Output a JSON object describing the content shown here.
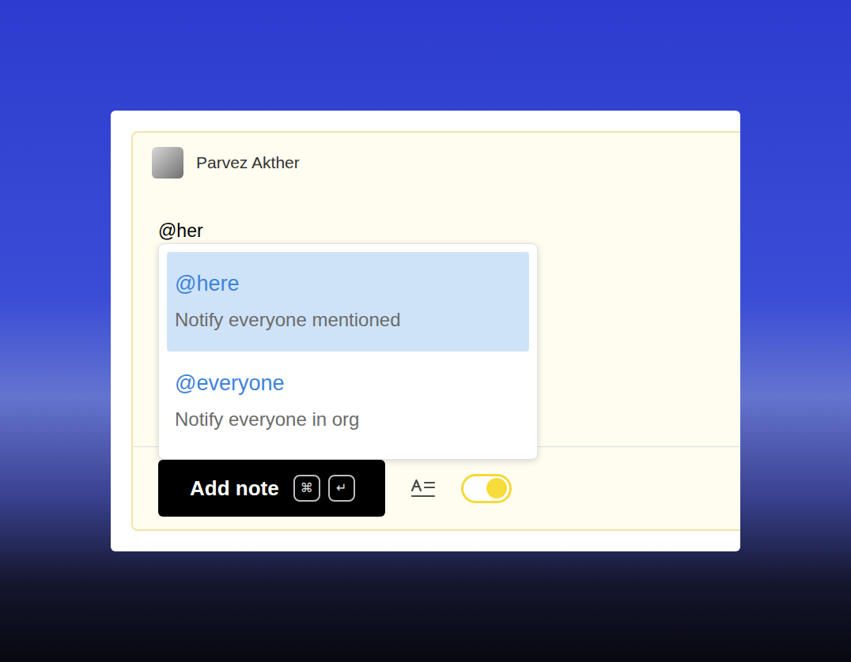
{
  "note": {
    "author": "Parvez Akther",
    "input": "@her"
  },
  "suggestions": [
    {
      "label": "@here",
      "description": "Notify everyone mentioned",
      "selected": true
    },
    {
      "label": "@everyone",
      "description": "Notify everyone in org",
      "selected": false
    }
  ],
  "footer": {
    "button": "Add note",
    "shortcut": [
      "⌘",
      "↵"
    ],
    "toggle": {
      "on": true
    }
  }
}
